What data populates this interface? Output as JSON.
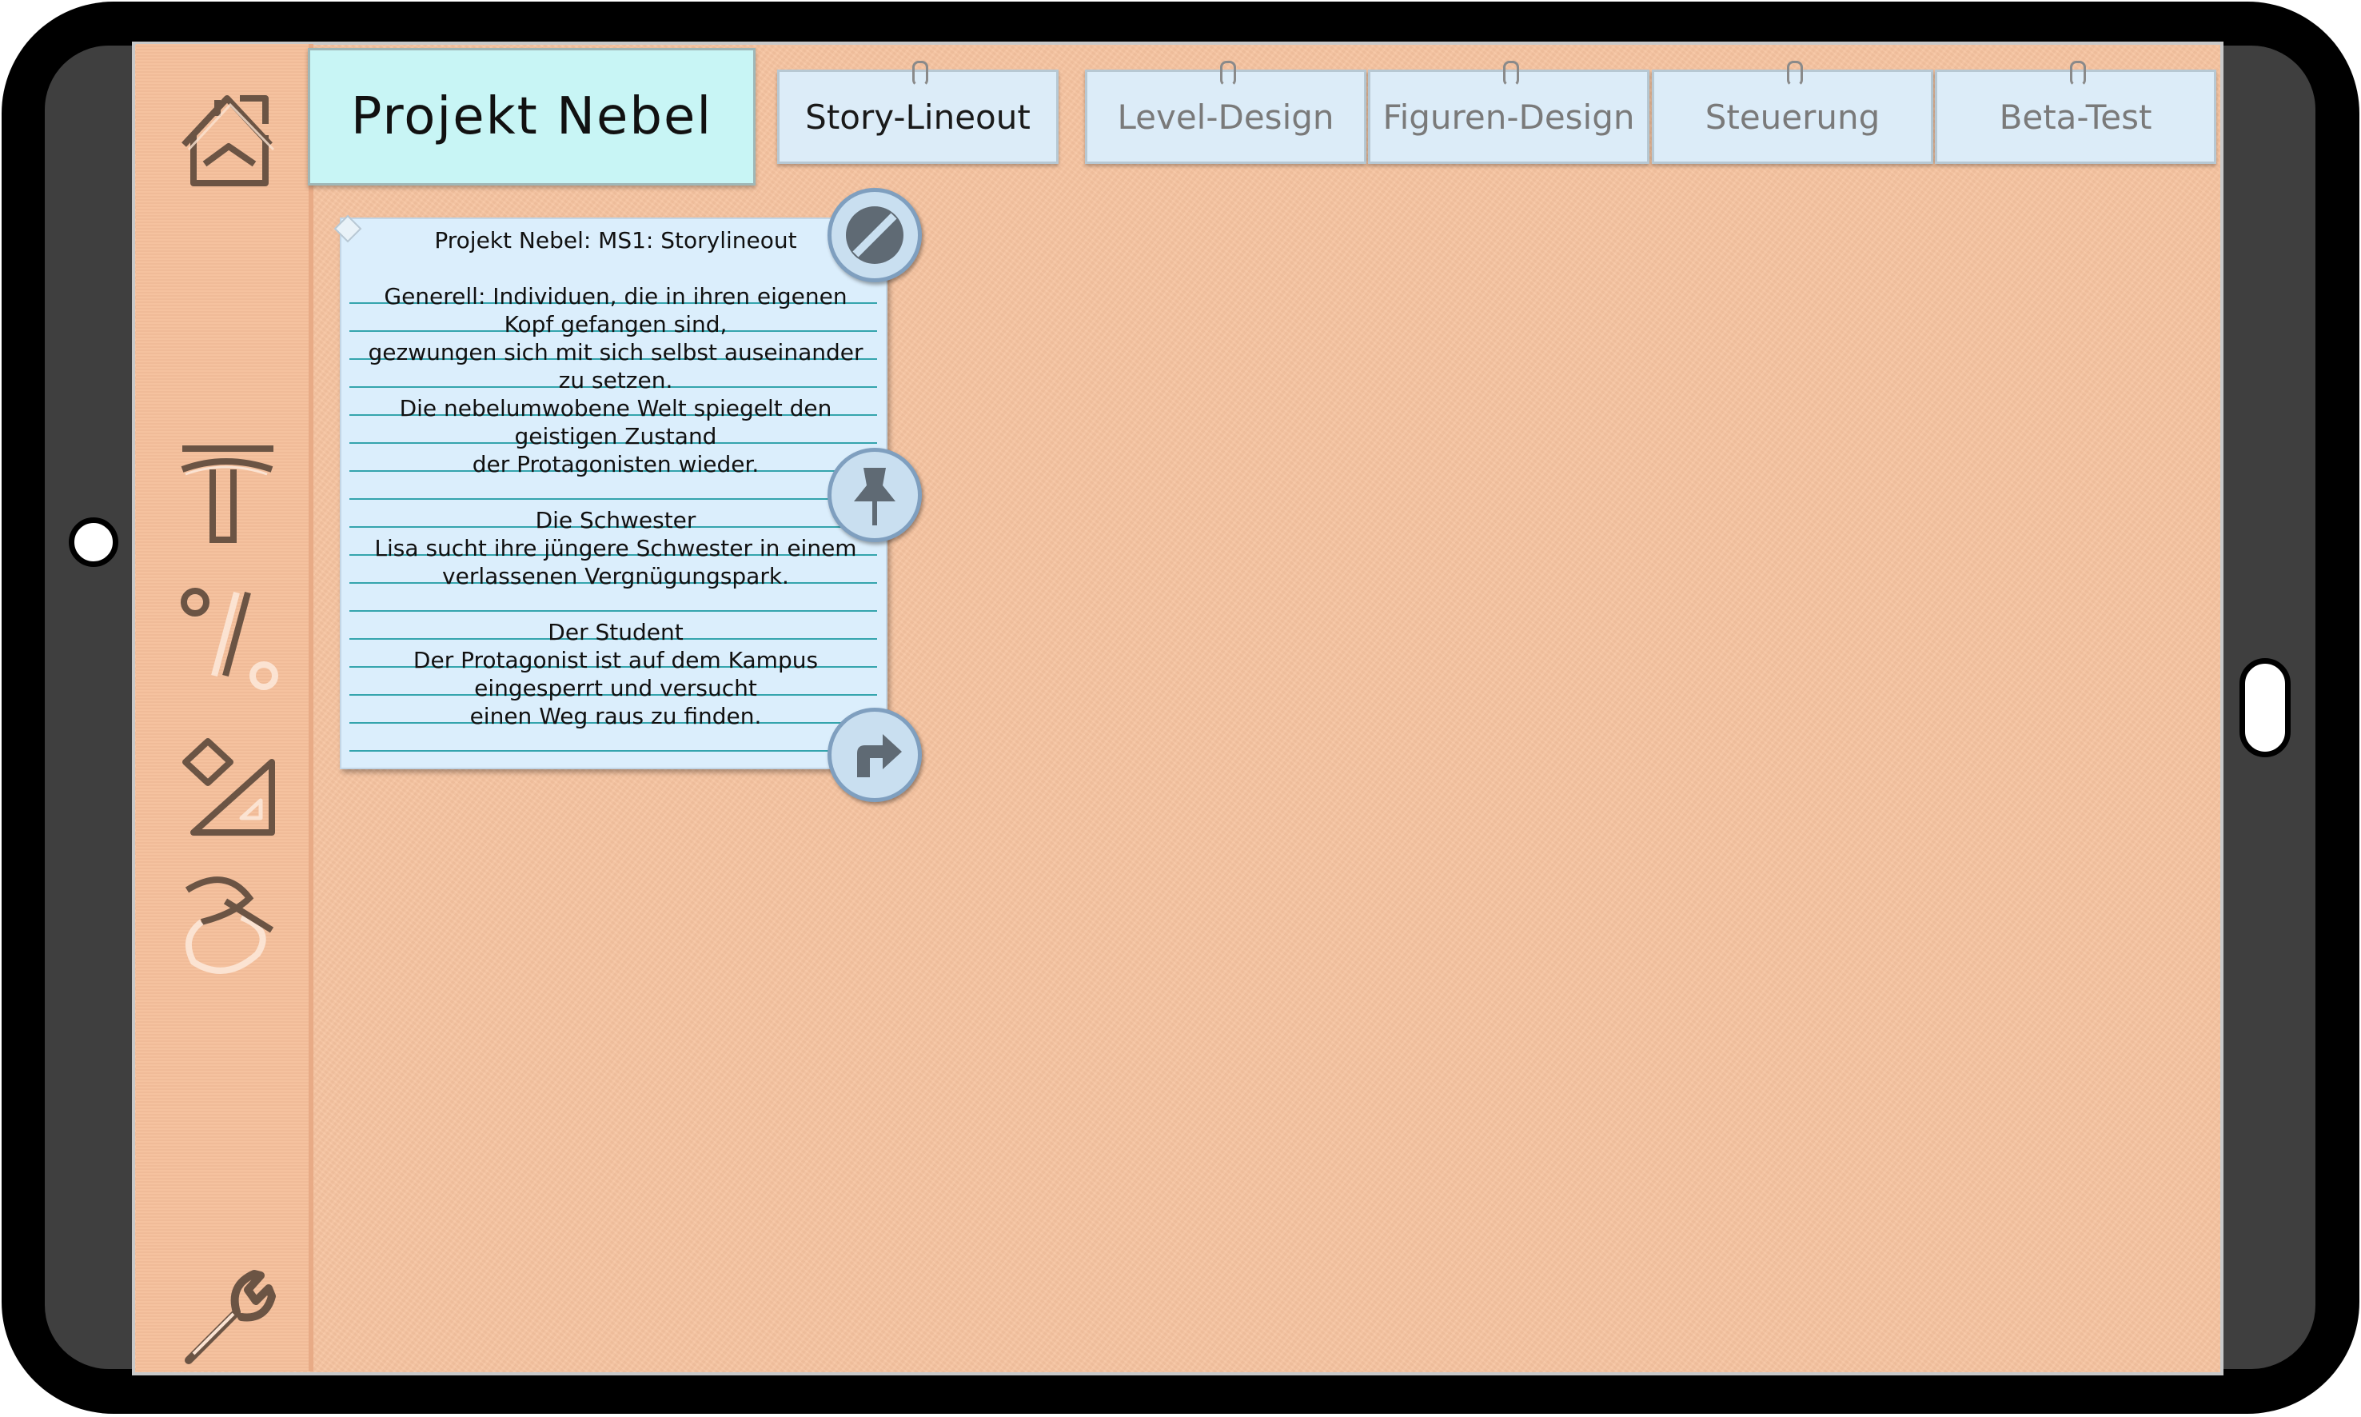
{
  "app": {
    "title": "Projekt Nebel"
  },
  "tabs": [
    {
      "label": "Story-Lineout",
      "active": true
    },
    {
      "label": "Level-Design",
      "active": false
    },
    {
      "label": "Figuren-Design",
      "active": false
    },
    {
      "label": "Steuerung",
      "active": false
    },
    {
      "label": "Beta-Test",
      "active": false
    }
  ],
  "sidebar": {
    "icons": [
      "home-icon",
      "text-tool-icon",
      "percent-icon",
      "triangle-ruler-icon",
      "curve-tool-icon",
      "wrench-icon"
    ]
  },
  "note": {
    "lines": [
      "Projekt Nebel: MS1: Storylineout",
      "",
      "Generell: Individuen, die in ihren eigenen",
      "Kopf gefangen sind,",
      "gezwungen sich mit sich selbst auseinander",
      "zu setzen.",
      "Die nebelumwobene Welt spiegelt den",
      "geistigen Zustand",
      "der Protagonisten wieder.",
      "",
      "Die Schwester",
      "Lisa sucht ihre jüngere Schwester in einem",
      "verlassenen Vergnügungspark.",
      "",
      "Der Student",
      "Der Protagonist ist auf dem Kampus",
      "eingesperrt und versucht",
      "einen Weg raus zu finden."
    ],
    "buttons": [
      "block-icon",
      "pin-icon",
      "rotate-icon"
    ]
  },
  "colors": {
    "background": "#f7c4a0",
    "sidebar": "#f5bf9b",
    "title_card": "#c8f5f5",
    "tab": "#dcecf8",
    "note": "#dbeefc",
    "note_rule": "#34a4ad",
    "bezel": "#3f3f3f"
  }
}
